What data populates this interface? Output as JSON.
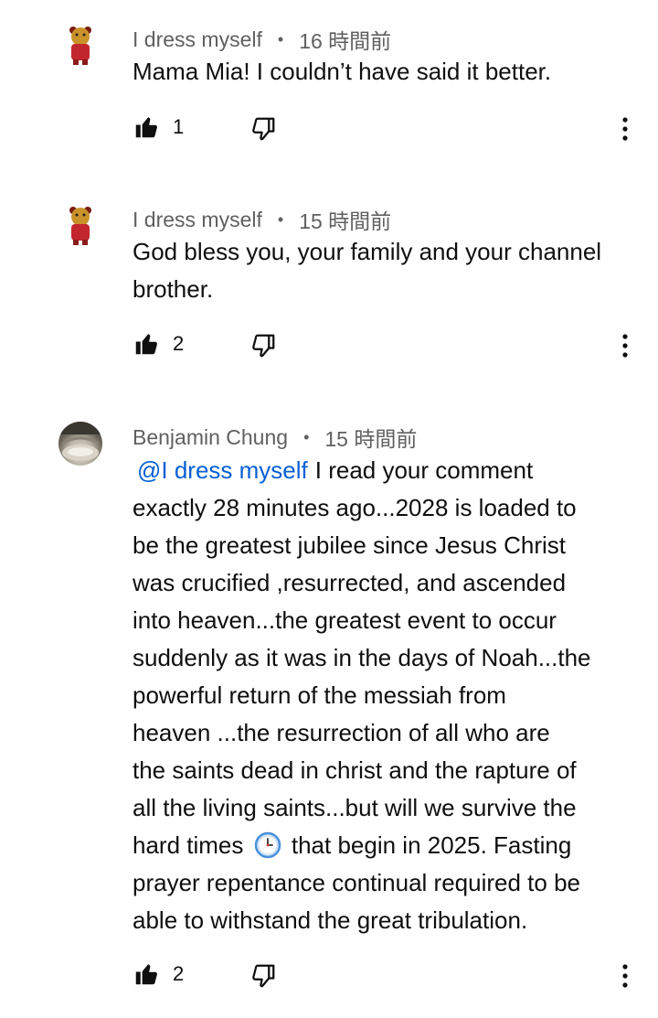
{
  "comments": [
    {
      "author": "I dress myself",
      "separator": "•",
      "time": "16 時間前",
      "text": "Mama Mia! I couldn’t have said it better.",
      "likes": "1",
      "avatar": "red-bear-avatar"
    },
    {
      "author": "I dress myself",
      "separator": "•",
      "time": "15 時間前",
      "text_line1": "God bless you, your family and your channel",
      "text_line2": "brother.",
      "likes": "2",
      "avatar": "red-bear-avatar"
    },
    {
      "author": "Benjamin Chung",
      "separator": "•",
      "time": "15 時間前",
      "mention": "@I dress myself",
      "lines": [
        "I read your comment",
        "exactly 28 minutes ago...2028 is loaded to",
        "be the greatest jubilee since Jesus Christ",
        "was crucified ,resurrected, and ascended",
        "into heaven...the greatest event to occur",
        "suddenly as it was in the days of Noah...the",
        "powerful return of the messiah from",
        "heaven ...the resurrection of all who are",
        "the saints dead in christ and the rapture of",
        "all the living saints...but will we survive the",
        "hard times",
        "that begin in 2025. Fasting",
        "prayer repentance continual required to be",
        "able to withstand the great tribulation."
      ],
      "likes": "2",
      "avatar": "stadium-photo-avatar"
    }
  ],
  "icons": {
    "like": "thumbs-up-icon",
    "dislike": "thumbs-down-icon",
    "more": "more-vert-icon",
    "emoji": "clock-emoji"
  },
  "colors": {
    "text": "#0f0f0f",
    "meta": "#606060",
    "mention": "#065fd4"
  }
}
